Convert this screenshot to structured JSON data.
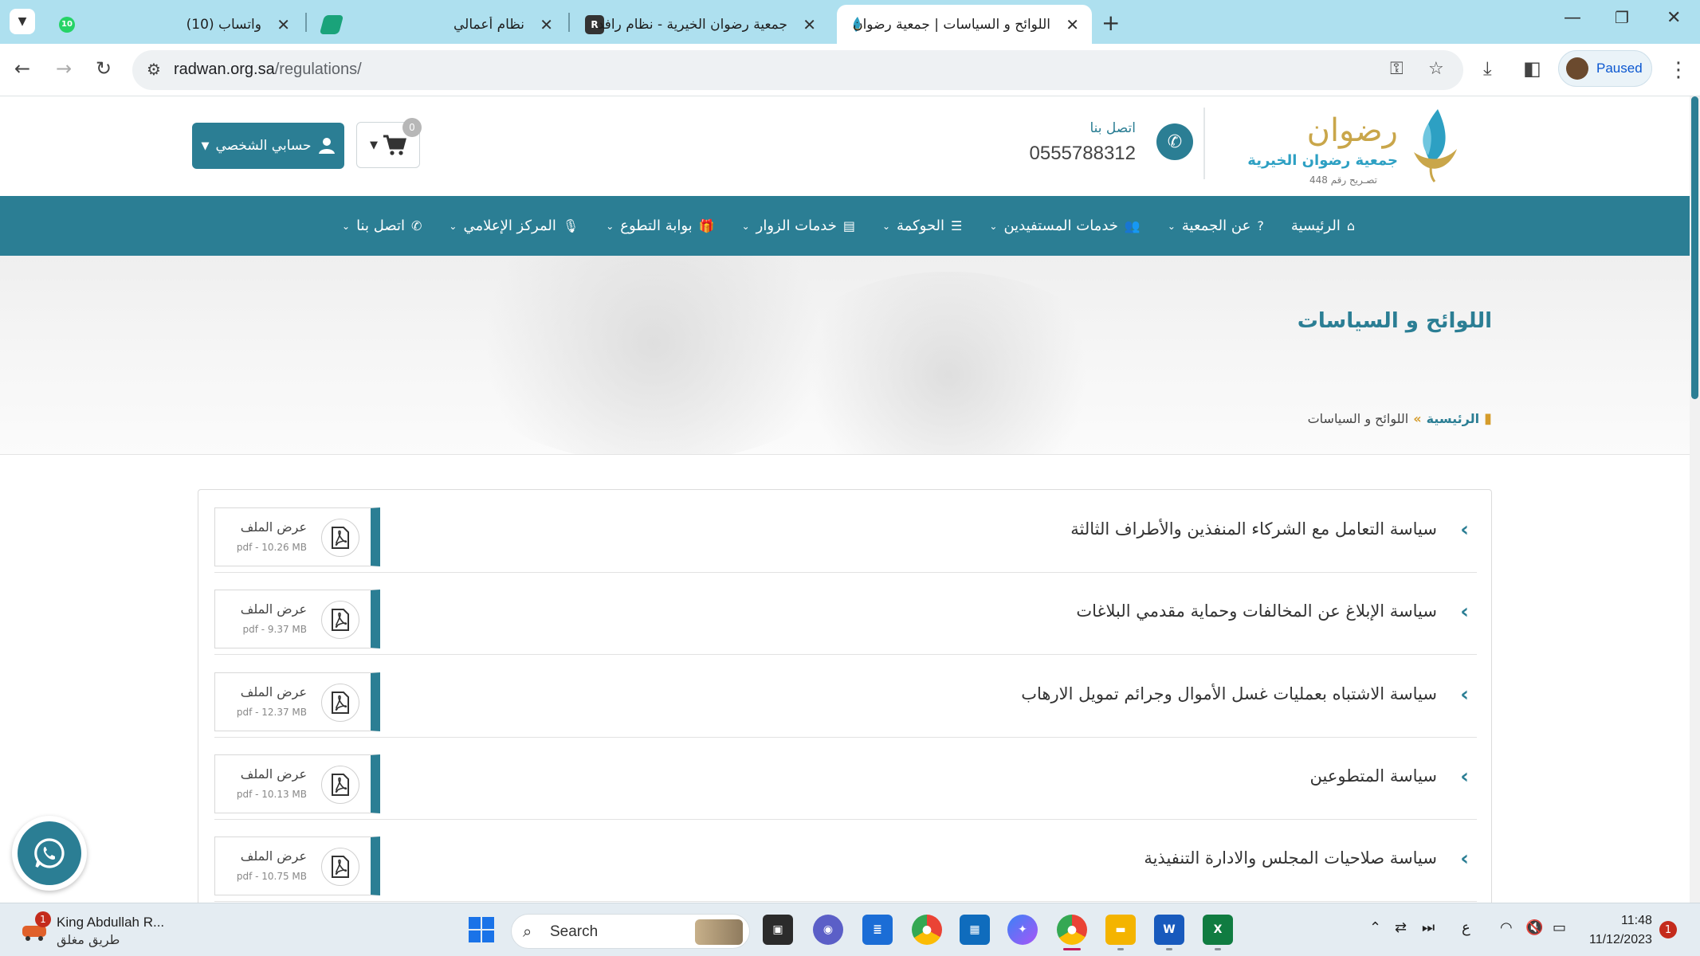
{
  "browser": {
    "tabs": [
      {
        "title": "واتساب (10)",
        "badge": "10",
        "active": false
      },
      {
        "title": "نظام أعمالي",
        "active": false
      },
      {
        "title": "جمعية رضوان الخيرية - نظام رافد",
        "active": false
      },
      {
        "title": "اللوائح و السياسات | جمعية رضوان",
        "active": true
      }
    ],
    "address": {
      "host": "radwan.org.sa",
      "path": "/regulations/"
    },
    "profile_label": "Paused"
  },
  "site": {
    "logo": {
      "name": "رضوان",
      "subtitle": "جمعية رضوان الخيرية",
      "license": "تصـريح رقم 448"
    },
    "contact": {
      "label": "اتصل بنا",
      "phone": "0555788312"
    },
    "cart_count": "0",
    "account_label": "حسابي الشخصي",
    "nav": [
      {
        "label": "الرئيسية",
        "icon": "home-icon",
        "glyph": "⌂",
        "dropdown": false
      },
      {
        "label": "عن الجمعية",
        "icon": "question-icon",
        "glyph": "?",
        "dropdown": true
      },
      {
        "label": "خدمات المستفيدين",
        "icon": "users-icon",
        "glyph": "👥",
        "dropdown": true
      },
      {
        "label": "الحوكمة",
        "icon": "list-icon",
        "glyph": "☰",
        "dropdown": true
      },
      {
        "label": "خدمات الزوار",
        "icon": "table-icon",
        "glyph": "▤",
        "dropdown": true
      },
      {
        "label": "بوابة التطوع",
        "icon": "gift-icon",
        "glyph": "🎁",
        "dropdown": true
      },
      {
        "label": "المركز الإعلامي",
        "icon": "microphone-icon",
        "glyph": "🎙",
        "dropdown": true
      },
      {
        "label": "اتصل بنا",
        "icon": "phone-icon",
        "glyph": "✆",
        "dropdown": true
      }
    ],
    "page_title": "اللوائح و السياسات",
    "breadcrumb": {
      "home": "الرئيسية",
      "separator": "»",
      "current": "اللوائح و السياسات"
    }
  },
  "regulations": [
    {
      "title": "سياسة التعامل مع الشركاء المنفذين والأطراف الثالثة",
      "file_label": "عرض الملف",
      "meta": "pdf - 10.26 MB"
    },
    {
      "title": "سياسة الإبلاغ عن المخالفات وحماية مقدمي البلاغات",
      "file_label": "عرض الملف",
      "meta": "pdf - 9.37 MB"
    },
    {
      "title": "سياسة الاشتباه بعمليات غسل الأموال وجرائم تمويل الارهاب",
      "file_label": "عرض الملف",
      "meta": "pdf - 12.37 MB"
    },
    {
      "title": "سياسة المتطوعين",
      "file_label": "عرض الملف",
      "meta": "pdf - 10.13 MB"
    },
    {
      "title": "سياسة صلاحيات المجلس والادارة التنفيذية",
      "file_label": "عرض الملف",
      "meta": "pdf - 10.75 MB"
    }
  ],
  "taskbar": {
    "weather_title": "King Abdullah R...",
    "weather_subtitle": "طريق مغلق",
    "weather_badge": "1",
    "search_label": "Search",
    "tray_lang": "ع",
    "time": "11:48",
    "date": "11/12/2023",
    "notifications": "1"
  },
  "colors": {
    "brand": "#2b7e94",
    "accent_gold": "#d59c2b"
  }
}
